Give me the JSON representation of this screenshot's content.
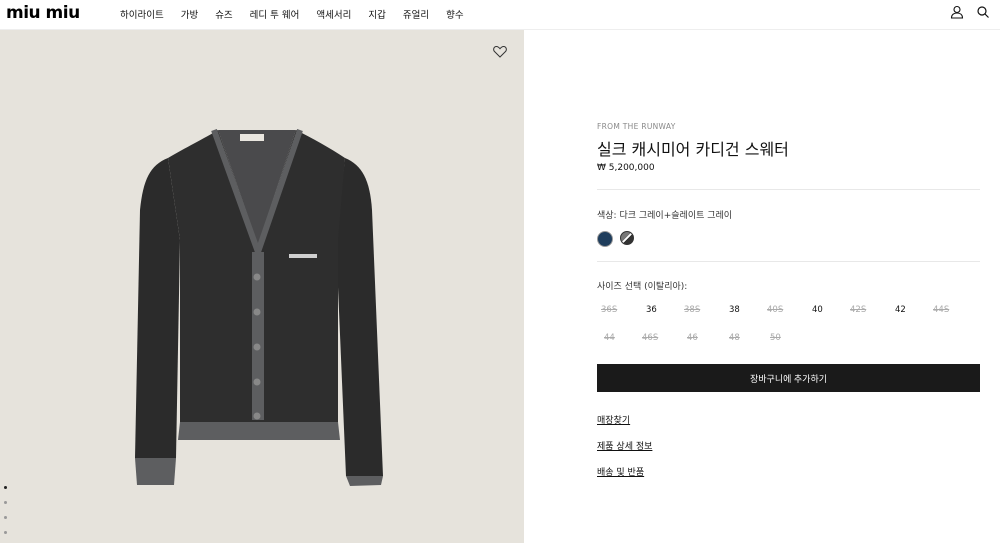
{
  "header": {
    "logo": "miu miu",
    "nav": [
      "하이라이트",
      "가방",
      "슈즈",
      "레디 투 웨어",
      "액세서리",
      "지갑",
      "쥬얼리",
      "향수"
    ],
    "icons": [
      "user-icon",
      "search-icon"
    ]
  },
  "gallery": {
    "wishlist_icon": "heart-icon",
    "dots_count": 4,
    "active_dot": 0,
    "colors": {
      "background": "#e6e3dc",
      "garment": "#2b2b2b",
      "trim": "#5d5e60"
    }
  },
  "product": {
    "eyebrow": "FROM THE RUNWAY",
    "title": "실크 캐시미어 카디건 스웨터",
    "price": "₩ 5,200,000",
    "color_label": "색상:  다크 그레이+슬레이트 그레이",
    "swatches": [
      {
        "name": "navy",
        "color": "#1f3d5c",
        "selected": false
      },
      {
        "name": "dark-gray-slate-gray",
        "color": "#555555",
        "selected": true
      }
    ],
    "size_label": "사이즈 선택 (이탈리아):",
    "sizes_row1": [
      {
        "label": "36S",
        "available": false
      },
      {
        "label": "36",
        "available": true
      },
      {
        "label": "38S",
        "available": false
      },
      {
        "label": "38",
        "available": true
      },
      {
        "label": "40S",
        "available": false
      },
      {
        "label": "40",
        "available": true
      },
      {
        "label": "42S",
        "available": false
      },
      {
        "label": "42",
        "available": true
      },
      {
        "label": "44S",
        "available": false
      }
    ],
    "sizes_row2": [
      {
        "label": "44",
        "available": false
      },
      {
        "label": "46S",
        "available": false
      },
      {
        "label": "46",
        "available": false
      },
      {
        "label": "48",
        "available": false
      },
      {
        "label": "50",
        "available": false
      }
    ],
    "add_to_cart": "장바구니에 추가하기",
    "links": [
      "매장찾기",
      "제품 상세 정보",
      "배송 및 반품"
    ]
  }
}
